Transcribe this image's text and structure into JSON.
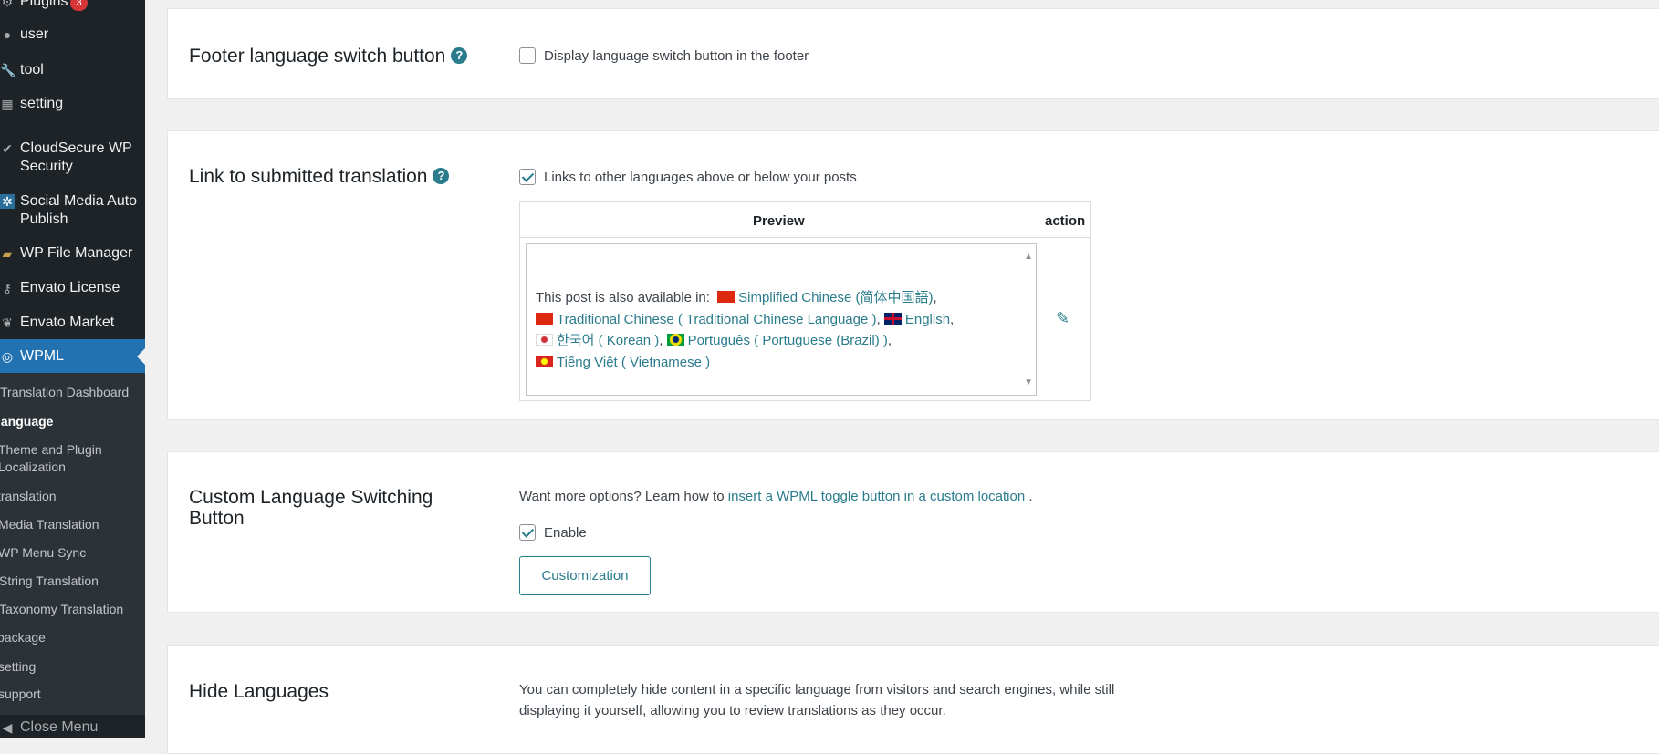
{
  "sidebar": {
    "items": [
      {
        "label": "Plugins",
        "badge": "3",
        "icon": "plugin-icon"
      },
      {
        "label": "user",
        "icon": "user-icon"
      },
      {
        "label": "tool",
        "icon": "wrench-icon"
      },
      {
        "label": "setting",
        "icon": "settings-icon"
      },
      {
        "label": "CloudSecure WP Security",
        "icon": "shield-check-icon"
      },
      {
        "label": "Social Media Auto Publish",
        "icon": "social-icon"
      },
      {
        "label": "WP File Manager",
        "icon": "folder-icon"
      },
      {
        "label": "Envato License",
        "icon": "key-icon"
      },
      {
        "label": "Envato Market",
        "icon": "envato-icon"
      }
    ],
    "active": {
      "label": "WPML",
      "icon": "wpml-icon"
    },
    "submenu": [
      "Translation Dashboard",
      "language",
      "Theme and Plugin Localization",
      "translation",
      "Media Translation",
      "WP Menu Sync",
      "String Translation",
      "Taxonomy Translation",
      "package",
      "setting",
      "support"
    ],
    "close": "Close Menu"
  },
  "footer_switch": {
    "title": "Footer language switch button",
    "help": "?",
    "checkbox": "Display language switch button in the footer",
    "checked": false
  },
  "link_translation": {
    "title": "Link to submitted translation",
    "help": "?",
    "checkbox": "Links to other languages above or below your posts",
    "checked": true,
    "col_preview": "Preview",
    "col_action": "action",
    "intro": "This post is also available in:",
    "langs": [
      {
        "name": "Simplified Chinese (简体中国語)",
        "sep": ",",
        "flag": "cn"
      },
      {
        "name": "Traditional Chinese ( Traditional Chinese Language )",
        "sep": ",",
        "flag": "cn"
      },
      {
        "name": "English",
        "sep": ",",
        "flag": "gb"
      },
      {
        "name": "한국어 ( Korean )",
        "sep": ",",
        "flag": "kr"
      },
      {
        "name": "Português ( Portuguese (Brazil) )",
        "sep": ",",
        "flag": "br"
      },
      {
        "name": "Tiếng Việt ( Vietnamese )",
        "sep": "",
        "flag": "vn"
      }
    ]
  },
  "custom_switch": {
    "title_1": "Custom Language Switching",
    "title_2": "Button",
    "text": "Want more options? Learn how to",
    "link": "insert a WPML toggle button in a custom location",
    "after": ".",
    "checkbox": "Enable",
    "checked": true,
    "button": "Customization"
  },
  "hide_languages": {
    "title": "Hide Languages",
    "text_1": "You can completely hide content in a specific language from visitors and search engines, while still",
    "text_2": "displaying it yourself, allowing you to review translations as they occur."
  },
  "colors": {
    "accent": "#2a7c8c",
    "sidebar": "#1d2327",
    "active": "#2271b1"
  }
}
